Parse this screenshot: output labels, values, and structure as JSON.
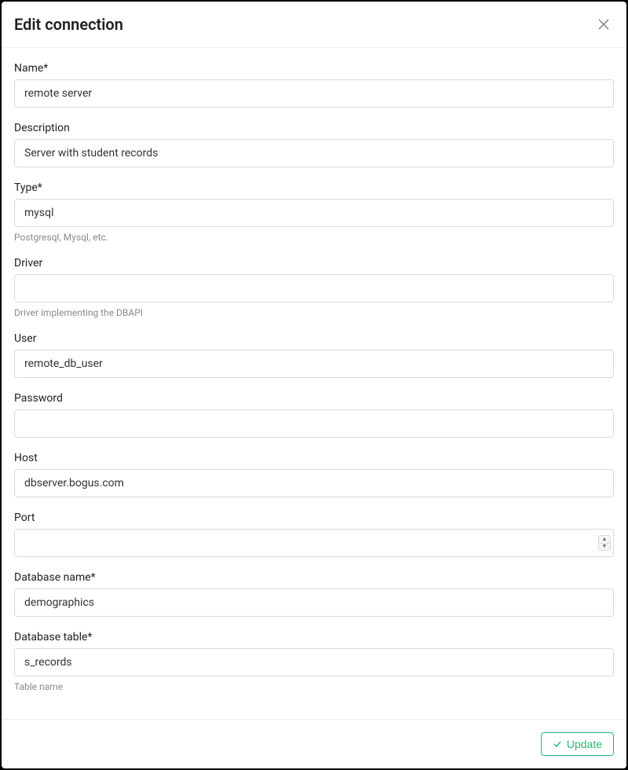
{
  "dialog": {
    "title": "Edit connection"
  },
  "fields": {
    "name": {
      "label": "Name*",
      "value": "remote server"
    },
    "description": {
      "label": "Description",
      "value": "Server with student records"
    },
    "type": {
      "label": "Type*",
      "value": "mysql",
      "hint": "Postgresql, Mysql, etc."
    },
    "driver": {
      "label": "Driver",
      "value": "",
      "hint": "Driver implementing the DBAPI"
    },
    "user": {
      "label": "User",
      "value": "remote_db_user"
    },
    "password": {
      "label": "Password",
      "value": ""
    },
    "host": {
      "label": "Host",
      "value": "dbserver.bogus.com"
    },
    "port": {
      "label": "Port",
      "value": ""
    },
    "dbname": {
      "label": "Database name*",
      "value": "demographics"
    },
    "dbtable": {
      "label": "Database table*",
      "value": "s_records",
      "hint": "Table name"
    }
  },
  "footer": {
    "update_label": "Update"
  }
}
